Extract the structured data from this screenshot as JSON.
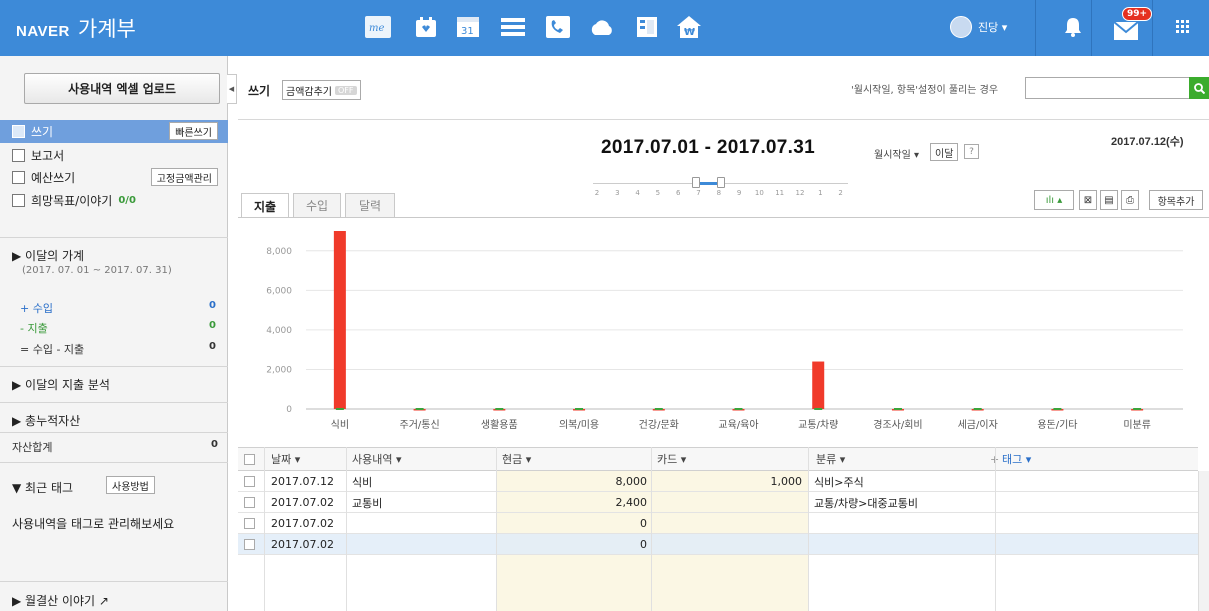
{
  "app": {
    "brand": "NAVER",
    "service": "가계부"
  },
  "topbar": {
    "icons": [
      "me-icon",
      "calendar-heart-icon",
      "calendar-31-icon",
      "list-icon",
      "contacts-icon",
      "cloud-icon",
      "memo-icon",
      "household-home-icon"
    ],
    "user_name": "진당 ▾",
    "mail_badge": "99+"
  },
  "sidebar": {
    "excel_button": "사용내역 엑셀 업로드",
    "menu": [
      {
        "label": "쓰기",
        "button": "빠른쓰기",
        "active": true
      },
      {
        "label": "보고서",
        "button": ""
      },
      {
        "label": "예산쓰기",
        "button": "고정금액관리"
      },
      {
        "label": "희망목표/이야기",
        "count": "0/0"
      }
    ],
    "this_month": {
      "title": "▶ 이달의 가계",
      "period": "(2017. 07. 01 ~ 2017. 07. 31)",
      "income_label": "+ 수입",
      "income_value": "0",
      "expense_label": "- 지출",
      "expense_value": "0",
      "net_label": "= 수입 - 지출",
      "net_value": "0"
    },
    "analysis_title": "▶ 이달의 지출 분석",
    "assets_title": "▶ 총누적자산",
    "assets_total_label": "자산합계",
    "assets_total_value": "0",
    "tags_title": "▼ 최근 태그",
    "tags_button": "사용방법",
    "tags_hint": "사용내역을 태그로 관리해보세요",
    "monthly_story": "▶ 월결산 이야기 ↗"
  },
  "toolbar": {
    "label": "쓰기",
    "toggle_label": "금액감추기",
    "toggle_state": "OFF",
    "search_note": "'월시작일, 항목'설정이 풀리는 경우",
    "search_placeholder": ""
  },
  "period": {
    "range": "2017.07.01  -  2017.07.31",
    "month_start_label": "월시작일 ▾",
    "month_select": "이달",
    "help": "?",
    "today": "2017.07.12(수)",
    "slider_ticks": [
      "2",
      "3",
      "4",
      "5",
      "6",
      "7",
      "8",
      "9",
      "10",
      "11",
      "12",
      "1",
      "2"
    ]
  },
  "tabs": [
    {
      "label": "지출",
      "active": true
    },
    {
      "label": "수입",
      "active": false
    },
    {
      "label": "달력",
      "active": false
    }
  ],
  "chart_tools": {
    "chart_toggle": "ılı ▴",
    "add_item": "항목추가"
  },
  "chart_data": {
    "type": "bar",
    "categories": [
      "식비",
      "주거/통신",
      "생활용품",
      "의복/미용",
      "건강/문화",
      "교육/육아",
      "교통/차량",
      "경조사/회비",
      "세금/이자",
      "용돈/기타",
      "미분류"
    ],
    "values": [
      9000,
      0,
      0,
      0,
      0,
      0,
      2400,
      0,
      0,
      0,
      0
    ],
    "yticks": [
      0,
      2000,
      4000,
      6000,
      8000
    ],
    "ytick_labels": [
      "0",
      "2,000",
      "4,000",
      "6,000",
      "8,000"
    ],
    "ylim": [
      0,
      9000
    ],
    "grid": true,
    "color": "#f03a2a"
  },
  "grid": {
    "headers": [
      "날짜 ▾",
      "사용내역 ▾",
      "현금 ▾",
      "카드 ▾",
      "분류 ▾",
      "태그 ▾"
    ],
    "add_marker": "+",
    "rows": [
      {
        "date": "2017.07.12",
        "desc": "식비",
        "cash": "8,000",
        "card": "1,000",
        "category": "식비>주식",
        "tag": ""
      },
      {
        "date": "2017.07.02",
        "desc": "교통비",
        "cash": "2,400",
        "card": "",
        "category": "교통/차량>대중교통비",
        "tag": ""
      },
      {
        "date": "2017.07.02",
        "desc": "",
        "cash": "0",
        "card": "",
        "category": "",
        "tag": ""
      },
      {
        "date": "2017.07.02",
        "desc": "",
        "cash": "0",
        "card": "",
        "category": "",
        "tag": ""
      }
    ]
  }
}
